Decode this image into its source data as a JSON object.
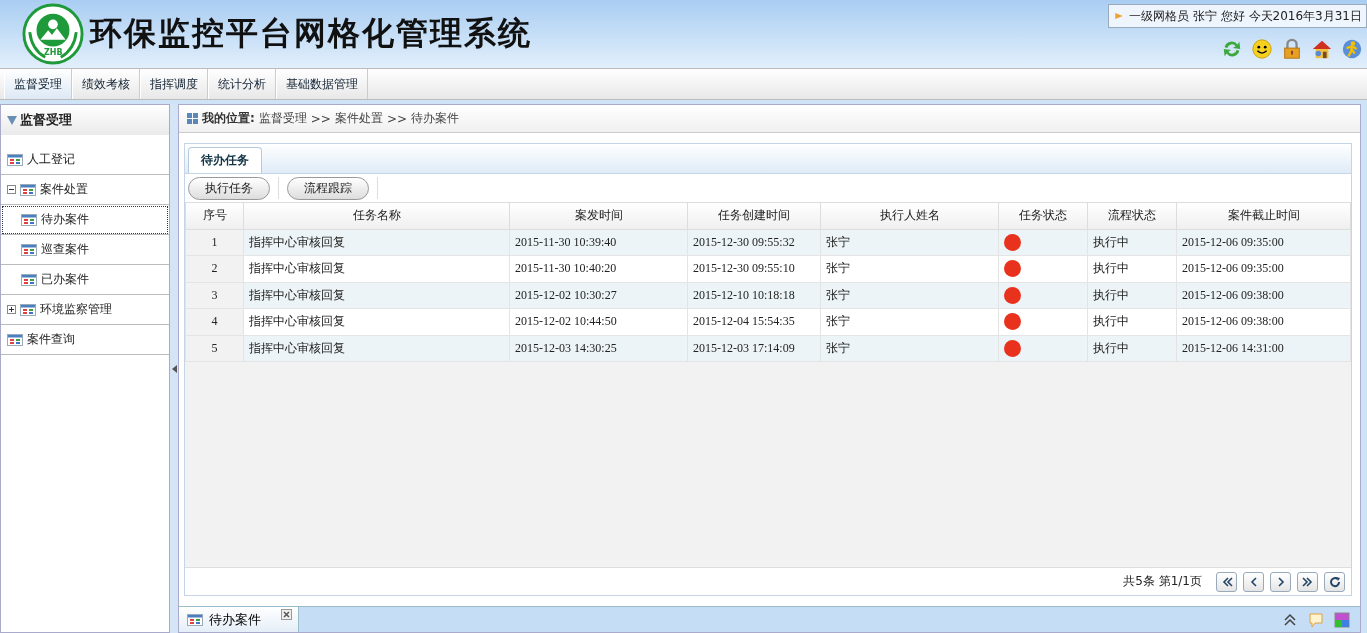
{
  "header": {
    "title": "环保监控平台网格化管理系统",
    "logo_text": "ZHB",
    "greeting": "一级网格员 张宁 您好 今天2016年3月31日"
  },
  "nav": [
    {
      "label": "监督受理",
      "selected": true
    },
    {
      "label": "绩效考核",
      "selected": false
    },
    {
      "label": "指挥调度",
      "selected": false
    },
    {
      "label": "统计分析",
      "selected": false
    },
    {
      "label": "基础数据管理",
      "selected": false
    }
  ],
  "sidebar": {
    "title": "监督受理",
    "items": [
      {
        "label": "人工登记",
        "selected": false
      },
      {
        "label": "案件处置",
        "selected": false,
        "expanded": true,
        "children": [
          {
            "label": "待办案件",
            "selected": true
          },
          {
            "label": "巡查案件",
            "selected": false
          },
          {
            "label": "已办案件",
            "selected": false
          }
        ]
      },
      {
        "label": "环境监察管理",
        "selected": false,
        "expanded": false
      },
      {
        "label": "案件查询",
        "selected": false
      }
    ]
  },
  "breadcrumb": {
    "label": "我的位置:",
    "path": [
      "监督受理",
      "案件处置",
      "待办案件"
    ],
    "separator": ">>"
  },
  "tabs": [
    {
      "label": "待办任务",
      "selected": true
    }
  ],
  "toolbar": [
    "执行任务",
    "流程跟踪"
  ],
  "table": {
    "columns": [
      "序号",
      "任务名称",
      "案发时间",
      "任务创建时间",
      "执行人姓名",
      "任务状态",
      "流程状态",
      "案件截止时间"
    ],
    "rows": [
      {
        "no": "1",
        "name": "指挥中心审核回复",
        "occurred": "2015-11-30 10:39:40",
        "created": "2015-12-30 09:55:32",
        "person": "张宁",
        "color": "#e8321e",
        "flow": "执行中",
        "deadline": "2015-12-06 09:35:00"
      },
      {
        "no": "2",
        "name": "指挥中心审核回复",
        "occurred": "2015-11-30 10:40:20",
        "created": "2015-12-30 09:55:10",
        "person": "张宁",
        "color": "#e8321e",
        "flow": "执行中",
        "deadline": "2015-12-06 09:35:00"
      },
      {
        "no": "3",
        "name": "指挥中心审核回复",
        "occurred": "2015-12-02 10:30:27",
        "created": "2015-12-10 10:18:18",
        "person": "张宁",
        "color": "#e8321e",
        "flow": "执行中",
        "deadline": "2015-12-06 09:38:00"
      },
      {
        "no": "4",
        "name": "指挥中心审核回复",
        "occurred": "2015-12-02 10:44:50",
        "created": "2015-12-04 15:54:35",
        "person": "张宁",
        "color": "#e8321e",
        "flow": "执行中",
        "deadline": "2015-12-06 09:38:00"
      },
      {
        "no": "5",
        "name": "指挥中心审核回复",
        "occurred": "2015-12-03 14:30:25",
        "created": "2015-12-03 17:14:09",
        "person": "张宁",
        "color": "#e8321e",
        "flow": "执行中",
        "deadline": "2015-12-06 14:31:00"
      }
    ]
  },
  "pager": {
    "summary": "共5条 第1/1页"
  },
  "bottom_tabs": [
    {
      "label": "待办案件",
      "selected": true
    }
  ]
}
